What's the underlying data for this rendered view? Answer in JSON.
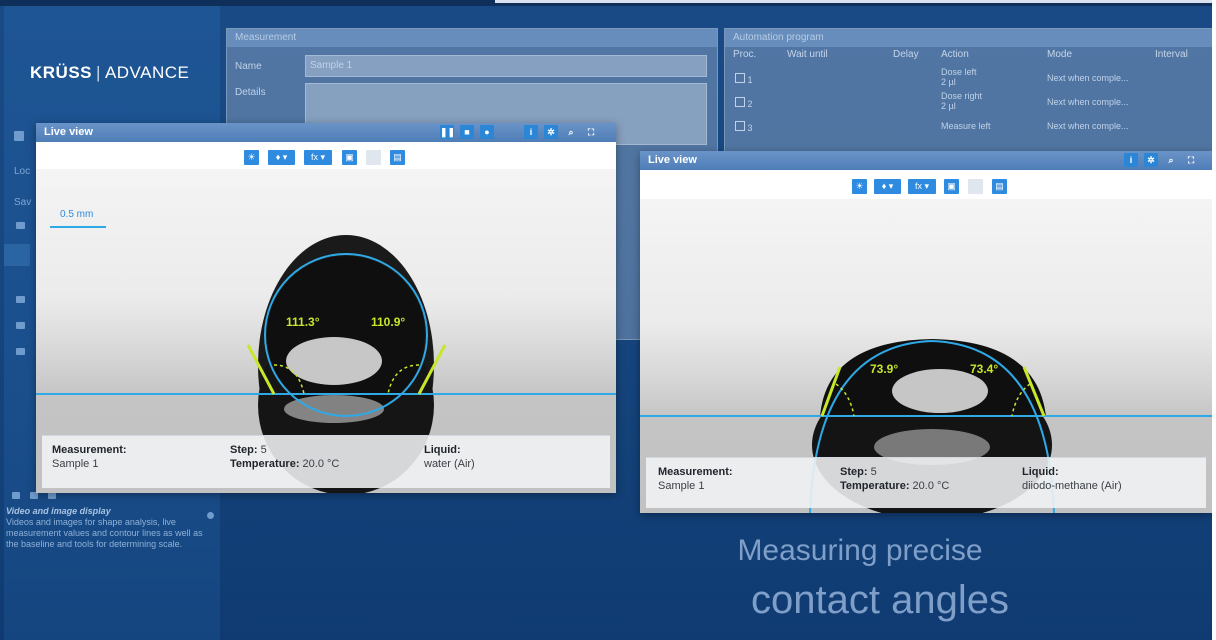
{
  "brand": {
    "name_bold": "KRÜSS",
    "name_rest": "ADVANCE"
  },
  "sidebar": {
    "items": [
      "Loc",
      "Sav"
    ],
    "caption_title": "Video and image display",
    "caption_text": "Videos and images for shape analysis, live measurement values and contour lines as well as the baseline and tools for determining scale."
  },
  "measurement_panel": {
    "title": "Measurement",
    "name_label": "Name",
    "name_value": "Sample 1",
    "details_label": "Details"
  },
  "automation_panel": {
    "title": "Automation program",
    "columns": [
      "Proc.",
      "Wait until",
      "Delay",
      "Action",
      "Mode",
      "Interval"
    ],
    "rows": [
      {
        "proc": "1",
        "action": "Dose left",
        "action_sub": "2 µl",
        "mode": "Next when comple..."
      },
      {
        "proc": "2",
        "action": "Dose right",
        "action_sub": "2 µl",
        "mode": "Next when comple..."
      },
      {
        "proc": "3",
        "action": "Measure left",
        "action_sub": "",
        "mode": "Next when comple..."
      }
    ]
  },
  "live_view_left": {
    "title": "Live view",
    "scale_label": "0.5 mm",
    "angle_left": "111.3°",
    "angle_right": "110.9°",
    "info": {
      "measurement_label": "Measurement:",
      "measurement_value": "Sample 1",
      "step_label": "Step:",
      "step_value": "5",
      "temperature_label": "Temperature:",
      "temperature_value": "20.0 °C",
      "liquid_label": "Liquid:",
      "liquid_value": "water (Air)"
    }
  },
  "live_view_right": {
    "title": "Live view",
    "angle_left": "73.9°",
    "angle_right": "73.4°",
    "info": {
      "measurement_label": "Measurement:",
      "measurement_value": "Sample 1",
      "step_label": "Step:",
      "step_value": "5",
      "temperature_label": "Temperature:",
      "temperature_value": "20.0 °C",
      "liquid_label": "Liquid:",
      "liquid_value": "diiodo-methane (Air)"
    }
  },
  "toolbar_icons": {
    "pause": "pause-icon",
    "camera": "camera-icon",
    "record": "record-icon",
    "info": "info-icon",
    "settings": "gear-icon",
    "zoom": "zoom-icon",
    "fit": "fit-icon",
    "brightness": "brightness-icon",
    "light": "bulb-icon",
    "function": "function-icon",
    "image": "image-icon",
    "snapshot": "snapshot-icon"
  },
  "headline": {
    "line1": "Measuring precise",
    "line2": "contact angles"
  },
  "colors": {
    "accent": "#2f8be0",
    "angle": "#c8e62a",
    "contour": "#2fa9e6",
    "background": "#17477f"
  }
}
